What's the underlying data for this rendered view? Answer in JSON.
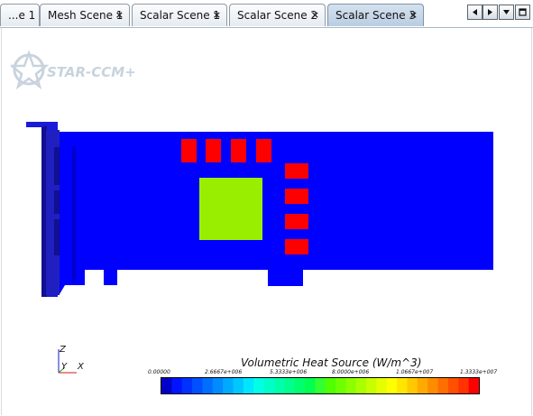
{
  "tabs": [
    {
      "label": "...e 1",
      "has_close": false,
      "active": false
    },
    {
      "label": "Mesh Scene 1",
      "has_close": true,
      "active": false
    },
    {
      "label": "Scalar Scene 1",
      "has_close": true,
      "active": false
    },
    {
      "label": "Scalar Scene 2",
      "has_close": true,
      "active": false
    },
    {
      "label": "Scalar Scene 3",
      "has_close": true,
      "active": true
    }
  ],
  "tab_close_glyph": "×",
  "tab_controls": {
    "left_icon": "triangle-left-icon",
    "right_icon": "triangle-right-icon",
    "list_icon": "triangle-down-icon",
    "maximize_icon": "maximize-icon"
  },
  "logo": {
    "text": "STAR-CCM+"
  },
  "scene": {
    "colors": {
      "low": "#0000ff",
      "mid": "#99ee00",
      "high": "#ff0000",
      "frame": "#1a1adb",
      "frame_dark": "#101090"
    },
    "components": [
      {
        "name": "board",
        "level": "low"
      },
      {
        "name": "center-chip",
        "level": "mid"
      },
      {
        "name": "top-chips",
        "count": 4,
        "level": "high"
      },
      {
        "name": "side-chips",
        "count": 4,
        "level": "high"
      }
    ]
  },
  "axes": {
    "z": "Z",
    "y": "Y",
    "x": "X"
  },
  "legend": {
    "title": "Volumetric Heat Source (W/m^3)",
    "min": 0.0,
    "max": 13333000,
    "ticks": [
      "0.00000",
      "2.6667e+006",
      "5.3333e+006",
      "8.0000e+006",
      "1.0667e+007",
      "1.3333e+007"
    ],
    "colors": [
      "#0000c8",
      "#0014ff",
      "#0032ff",
      "#0050ff",
      "#006eff",
      "#008cff",
      "#00aaff",
      "#00c8ff",
      "#00e6ff",
      "#00ffe6",
      "#00ffc8",
      "#00ffaa",
      "#00ff8c",
      "#00ff6e",
      "#00ff50",
      "#32ff32",
      "#50ff00",
      "#6eff00",
      "#8cff00",
      "#aaff00",
      "#c8ff00",
      "#e6ff00",
      "#ffff00",
      "#ffe600",
      "#ffc800",
      "#ffaa00",
      "#ff8c00",
      "#ff6e00",
      "#ff5000",
      "#ff3200",
      "#ff0000"
    ]
  }
}
